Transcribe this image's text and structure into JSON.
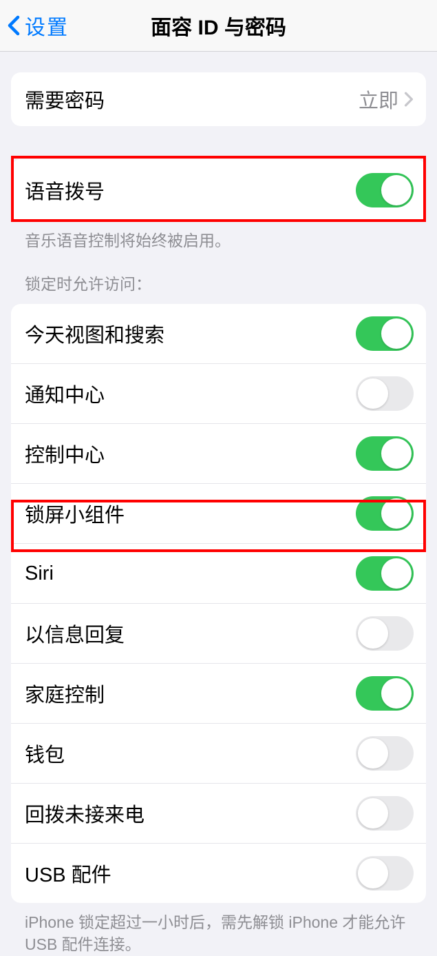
{
  "nav": {
    "back_label": "设置",
    "title": "面容 ID 与密码"
  },
  "passcode": {
    "label": "需要密码",
    "value": "立即"
  },
  "voice_dial": {
    "label": "语音拨号",
    "enabled": true,
    "footer": "音乐语音控制将始终被启用。"
  },
  "locked_section": {
    "header": "锁定时允许访问：",
    "items": [
      {
        "label": "今天视图和搜索",
        "enabled": true
      },
      {
        "label": "通知中心",
        "enabled": false
      },
      {
        "label": "控制中心",
        "enabled": true
      },
      {
        "label": "锁屏小组件",
        "enabled": true
      },
      {
        "label": "Siri",
        "enabled": true
      },
      {
        "label": "以信息回复",
        "enabled": false
      },
      {
        "label": "家庭控制",
        "enabled": true
      },
      {
        "label": "钱包",
        "enabled": false
      },
      {
        "label": "回拨未接来电",
        "enabled": false
      },
      {
        "label": "USB 配件",
        "enabled": false
      }
    ],
    "footer": "iPhone 锁定超过一小时后，需先解锁 iPhone 才能允许USB 配件连接。"
  }
}
